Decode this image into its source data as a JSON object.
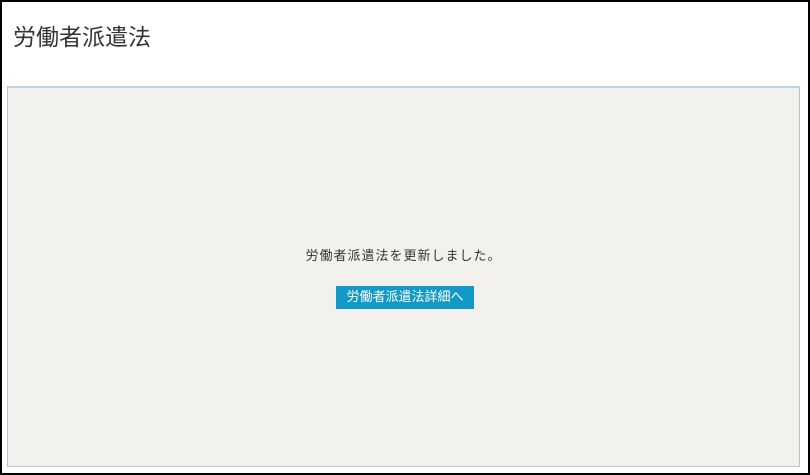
{
  "page": {
    "title": "労働者派遣法"
  },
  "content": {
    "message": "労働者派遣法を更新しました。",
    "detail_link_label": "労働者派遣法詳細へ"
  },
  "colors": {
    "panel_background": "#f2f1ee",
    "button_background": "#1399c6",
    "panel_top_border": "#bcd6e6"
  }
}
